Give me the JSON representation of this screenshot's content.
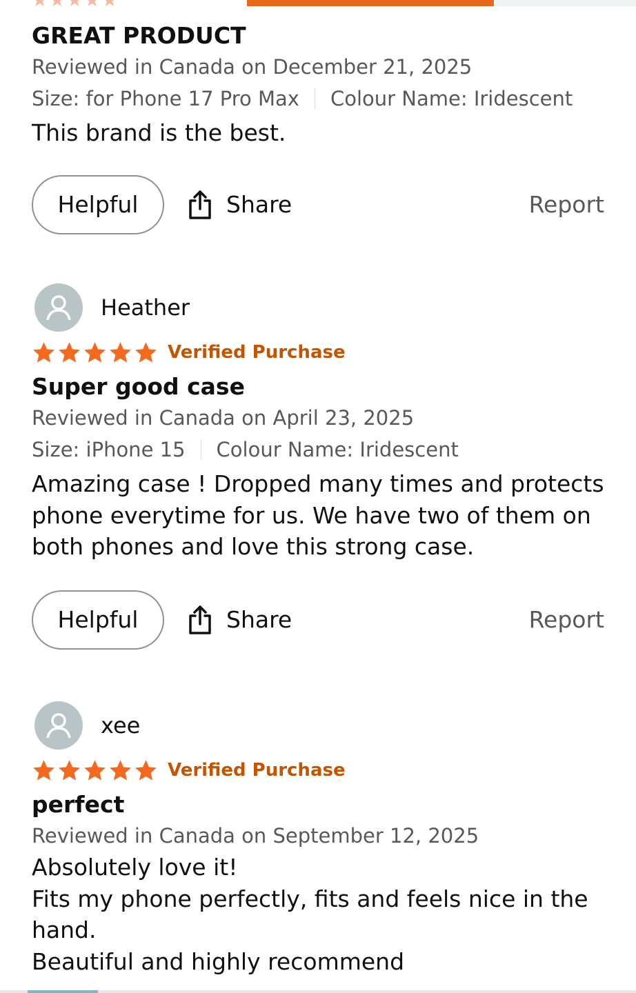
{
  "colors": {
    "star": "#f3691d",
    "verified": "#c45500",
    "text_primary": "#0f1111",
    "text_secondary": "#565959",
    "avatar_bg": "#b9c4c6",
    "top_bar_accent": "#e8691c"
  },
  "top": {
    "partial_stars_icon": "star-icon"
  },
  "reviews": [
    {
      "title": "GREAT PRODUCT",
      "reviewed": "Reviewed in Canada on December 21, 2025",
      "size": "Size: for Phone 17 Pro Max",
      "colour": "Colour Name: Iridescent",
      "body": "This brand is the best.",
      "helpful_label": "Helpful",
      "share_label": "Share",
      "report_label": "Report"
    },
    {
      "reviewer": "Heather",
      "rating": 5,
      "verified": "Verified Purchase",
      "title": "Super good case",
      "reviewed": "Reviewed in Canada on April 23, 2025",
      "size": "Size: iPhone 15",
      "colour": "Colour Name: Iridescent",
      "body_lines": [
        "Amazing case ! Dropped many times and protects",
        "phone everytime for us. We have two of them on",
        "both phones and love this strong case."
      ],
      "helpful_label": "Helpful",
      "share_label": "Share",
      "report_label": "Report"
    },
    {
      "reviewer": "xee",
      "rating": 5,
      "verified": "Verified Purchase",
      "title": "perfect",
      "reviewed": "Reviewed in Canada on September 12, 2025",
      "body_lines": [
        "Absolutely love it!",
        "Fits my phone perfectly, fits and feels nice in the",
        "hand.",
        "Beautiful and highly recommend"
      ]
    }
  ]
}
